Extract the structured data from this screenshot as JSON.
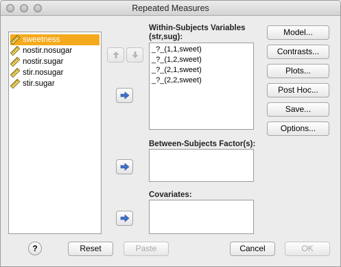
{
  "window": {
    "title": "Repeated Measures"
  },
  "source_variables": [
    {
      "label": "sweetness",
      "selected": true
    },
    {
      "label": "nostir.nosugar",
      "selected": false
    },
    {
      "label": "nostir.sugar",
      "selected": false
    },
    {
      "label": "stir.nosugar",
      "selected": false
    },
    {
      "label": "stir.sugar",
      "selected": false
    }
  ],
  "within": {
    "label_line1": "Within-Subjects Variables",
    "label_line2": "(str,sug):",
    "items": [
      "_?_(1,1,sweet)",
      "_?_(1,2,sweet)",
      "_?_(2,1,sweet)",
      "_?_(2,2,sweet)"
    ]
  },
  "between": {
    "label": "Between-Subjects Factor(s):"
  },
  "covariates": {
    "label": "Covariates:"
  },
  "side_buttons": {
    "model": "Model...",
    "contrasts": "Contrasts...",
    "plots": "Plots...",
    "posthoc": "Post Hoc...",
    "save": "Save...",
    "options": "Options..."
  },
  "footer": {
    "help": "?",
    "reset": "Reset",
    "paste": "Paste",
    "cancel": "Cancel",
    "ok": "OK"
  },
  "colors": {
    "selection": "#f5a91c",
    "arrow": "#3f6fc8"
  }
}
